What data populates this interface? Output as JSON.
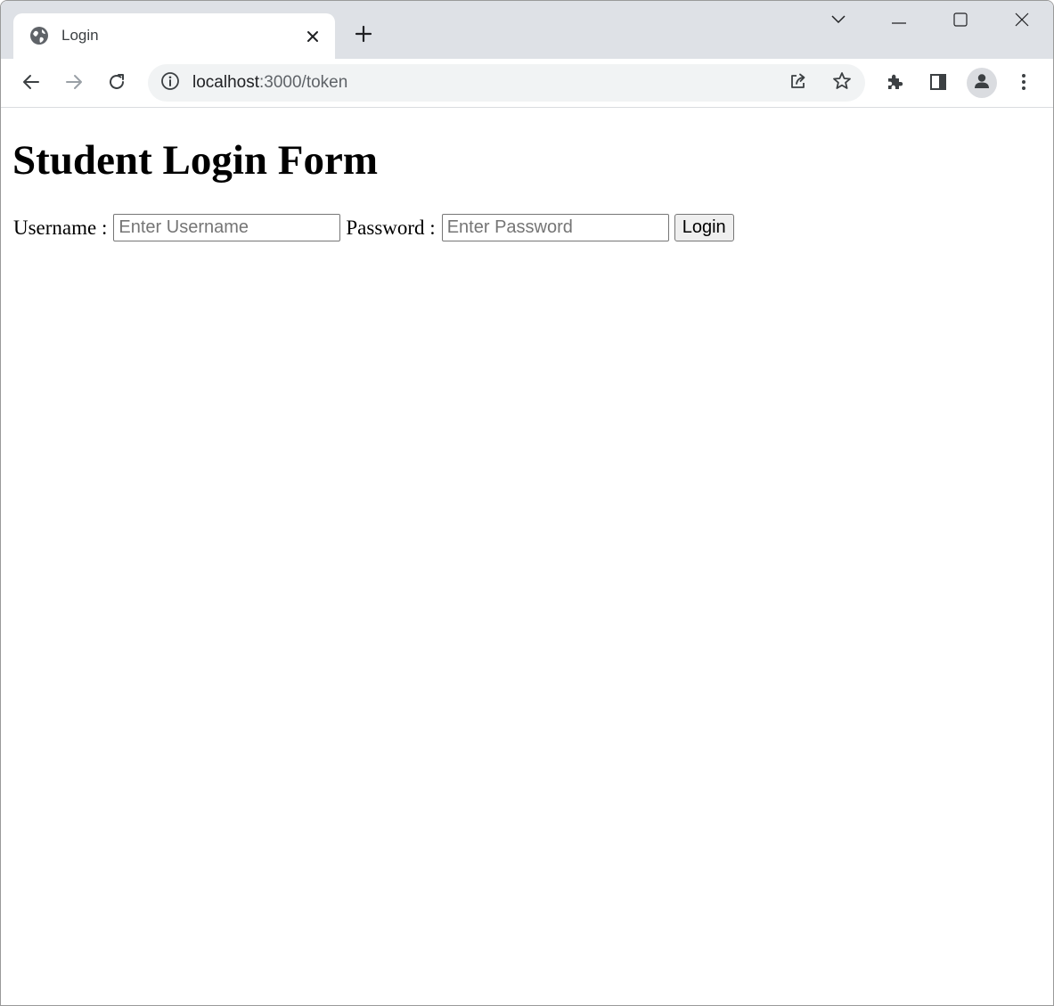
{
  "browser": {
    "tab": {
      "title": "Login",
      "favicon_icon": "globe-icon",
      "close_icon": "close-icon"
    },
    "new_tab_icon": "plus-icon",
    "window_controls": [
      "chevron-down-icon",
      "minimize-icon",
      "maximize-icon",
      "close-icon"
    ],
    "toolbar": {
      "back_icon": "back-arrow-icon",
      "forward_icon": "forward-arrow-icon",
      "reload_icon": "reload-icon",
      "site_info_icon": "info-icon",
      "url_host": "localhost",
      "url_path": ":3000/token",
      "share_icon": "share-icon",
      "bookmark_icon": "star-icon",
      "extensions_icon": "puzzle-icon",
      "side_panel_icon": "side-panel-icon",
      "profile_icon": "person-icon",
      "menu_icon": "kebab-menu-icon"
    }
  },
  "page": {
    "title": "Student Login Form",
    "form": {
      "username_label": "Username :",
      "username_placeholder": "Enter Username",
      "username_value": "",
      "password_label": "Password :",
      "password_placeholder": "Enter Password",
      "password_value": "",
      "login_label": "Login"
    }
  },
  "colors": {
    "tabstrip_bg": "#dee1e6",
    "omnibox_bg": "#f1f3f4",
    "icon": "#5f6368",
    "button_bg": "#efefef"
  }
}
